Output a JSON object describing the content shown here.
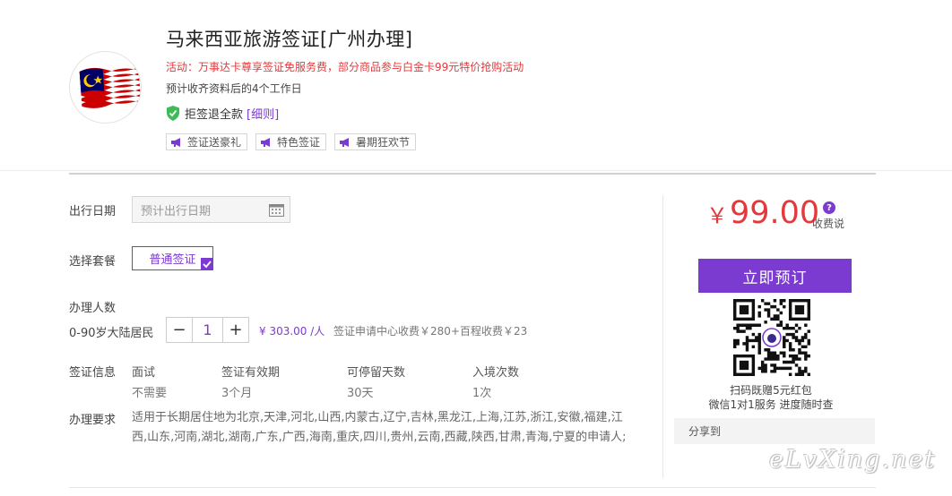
{
  "product": {
    "title": "马来西亚旅游签证[广州办理]",
    "promo": "活动：万事达卡尊享签证免服务费，部分商品参与白金卡99元特价抢购活动",
    "eta": "预计收齐资料后的4个工作日",
    "refund_text": "拒签退全款",
    "refund_link": "[细则]",
    "tags": [
      "签证送豪礼",
      "特色签证",
      "暑期狂欢节"
    ]
  },
  "form": {
    "date_label": "出行日期",
    "date_placeholder": "预计出行日期",
    "package_label": "选择套餐",
    "package_option": "普通签证",
    "people_label": "办理人数",
    "people_type": "0-90岁大陆居民",
    "minus": "−",
    "plus": "+",
    "quantity": "1",
    "unit_price": "¥ 303.00 /人",
    "fee_note": "签证申请中心收费￥280+百程收费￥23",
    "visa_info_label": "签证信息",
    "visa_info": [
      {
        "header": "面试",
        "value": "不需要"
      },
      {
        "header": "签证有效期",
        "value": "3个月"
      },
      {
        "header": "可停留天数",
        "value": "30天"
      },
      {
        "header": "入境次数",
        "value": "1次"
      }
    ],
    "requirement_label": "办理要求",
    "requirement_text": "适用于长期居住地为北京,天津,河北,山西,内蒙古,辽宁,吉林,黑龙江,上海,江苏,浙江,安徽,福建,江西,山东,河南,湖北,湖南,广东,广西,海南,重庆,四川,贵州,云南,西藏,陕西,甘肃,青海,宁夏的申请人;"
  },
  "side": {
    "currency": "￥",
    "price": "99.00",
    "help_icon_text": "?",
    "fee_desc": "收费说",
    "book_button": "立即预订",
    "qr_line1": "扫码既赠5元红包",
    "qr_line2": "微信1对1服务 进度随时查",
    "share": "分享到",
    "watermark": "eLvXing.net"
  },
  "colors": {
    "accent": "#7b3bd1",
    "price": "#e4393c"
  }
}
